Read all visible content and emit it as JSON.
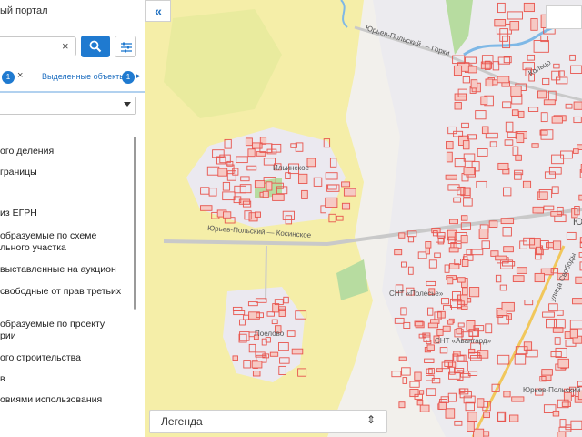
{
  "header": {
    "portal_title": "ый портал"
  },
  "search": {
    "value": "",
    "clear_glyph": "×"
  },
  "tabs": {
    "badge_left": "1",
    "close_glyph": "×",
    "selected_label": "Выделенные объекты",
    "badge_right": "1",
    "arrow": "▸"
  },
  "layer_select": {
    "value": ""
  },
  "layers": [
    "ого деления",
    "границы",
    "из ЕГРН",
    "образуемые по схеме",
    "льного участка",
    "выставленные на аукцион",
    "свободные от прав третьих",
    "образуемые по проекту",
    "рии",
    "ого строительства",
    "в",
    "овиями использования"
  ],
  "map": {
    "labels": {
      "road_gorki": "Юрьев-Польский — Горки",
      "road_kosinskoe": "Юрьев-Польский — Косинское",
      "village_ilyinskoe": "Ильинское",
      "village_poelovo": "Поелово",
      "snt_1": "СНТ «Полесье»",
      "snt_2": "СНТ «Авангард»",
      "town": "Юрьев-Польский",
      "town_edge": "Ю",
      "street_1": "Кольцо",
      "street_2": "улица Свободы"
    },
    "collapse_glyph": "«"
  },
  "legend": {
    "label": "Легенда",
    "toggle_glyph": "⇕"
  },
  "colors": {
    "accent": "#1f7ad0",
    "parcel": "#e8554e",
    "yellow_zone": "#f5eea8",
    "grey_zone": "#ebe9f0"
  }
}
